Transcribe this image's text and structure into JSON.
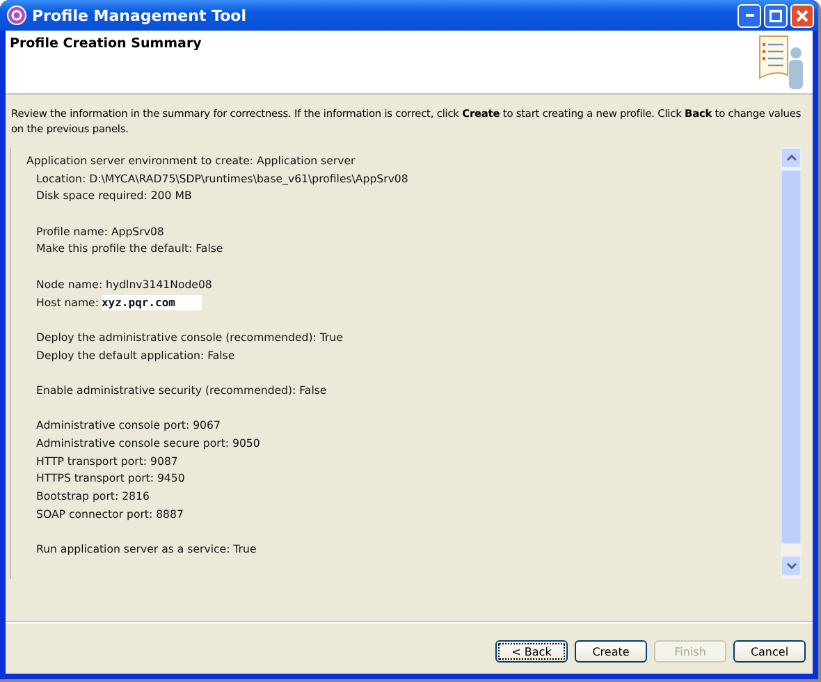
{
  "window": {
    "title": "Profile Management Tool",
    "controls": [
      {
        "kind": "minimize"
      },
      {
        "kind": "maximize"
      },
      {
        "kind": "close"
      }
    ]
  },
  "header": {
    "title": "Profile Creation Summary"
  },
  "description": "Review the information in the summary for correctness. If the information is correct, click **Create** to start creating a new profile. Click **Back** to change values on the previous panels.",
  "summary": {
    "heading": "Application server environment to create: Application server",
    "groups": [
      {
        "lines": [
          {
            "text": "Location: D:\\MYCA\\RAD75\\SDP\\runtimes\\base_v61\\profiles\\AppSrv08"
          },
          {
            "text": "Disk space required: 200 MB"
          }
        ]
      },
      {
        "lines": [
          {
            "text": "Profile name: AppSrv08"
          },
          {
            "text": "Make this profile the default: False"
          }
        ]
      },
      {
        "lines": [
          {
            "text": "Node name: hydlnv3141Node08"
          },
          {
            "kind": "highlighted",
            "text": "Host name:",
            "value": "xyz.pqr.com"
          }
        ]
      },
      {
        "lines": [
          {
            "text": "Deploy the administrative console (recommended): True"
          },
          {
            "text": "Deploy the default application: False"
          }
        ]
      },
      {
        "lines": [
          {
            "text": "Enable administrative security (recommended): False"
          }
        ]
      },
      {
        "lines": [
          {
            "text": "Administrative console port: 9067"
          },
          {
            "text": "Administrative console secure port: 9050"
          },
          {
            "text": "HTTP transport port: 9087"
          },
          {
            "text": "HTTPS transport port: 9450"
          },
          {
            "text": "Bootstrap port: 2816"
          },
          {
            "text": "SOAP connector port: 8887"
          }
        ]
      },
      {
        "lines": [
          {
            "text": "Run application server as a service: True"
          }
        ]
      }
    ]
  },
  "buttons": [
    {
      "label": "< Back",
      "focused": true,
      "disabled": false
    },
    {
      "label": "Create",
      "focused": false,
      "disabled": false
    },
    {
      "label": "Finish",
      "focused": false,
      "disabled": true
    },
    {
      "label": "Cancel",
      "focused": false,
      "disabled": false
    }
  ]
}
